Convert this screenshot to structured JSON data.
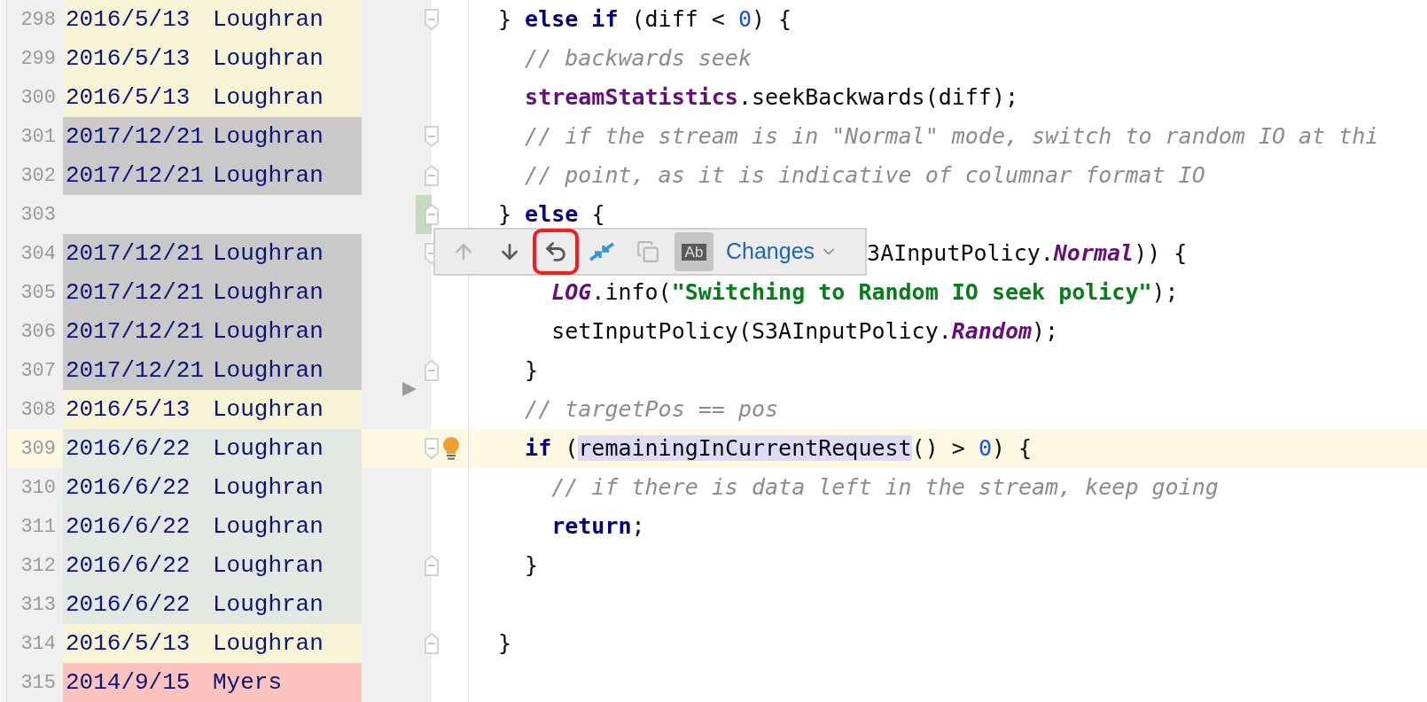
{
  "rows": [
    {
      "line_number": "298",
      "blame": {
        "date": "2016/5/13",
        "author": "Loughran",
        "color": "#f7f3d5"
      },
      "fold_start": true
    },
    {
      "line_number": "299",
      "blame": {
        "date": "2016/5/13",
        "author": "Loughran",
        "color": "#f7f3d5"
      }
    },
    {
      "line_number": "300",
      "blame": {
        "date": "2016/5/13",
        "author": "Loughran",
        "color": "#f7f3d5"
      }
    },
    {
      "line_number": "301",
      "blame": {
        "date": "2017/12/21",
        "author": "Loughran",
        "color": "#c9c9c9"
      },
      "fold_start": true
    },
    {
      "line_number": "302",
      "blame": {
        "date": "2017/12/21",
        "author": "Loughran",
        "color": "#c9c9c9"
      },
      "fold_end": true
    },
    {
      "line_number": "303",
      "changed": true,
      "fold_end": true
    },
    {
      "line_number": "304",
      "blame": {
        "date": "2017/12/21",
        "author": "Loughran",
        "color": "#c9c9c9"
      },
      "fold_start": true
    },
    {
      "line_number": "305",
      "blame": {
        "date": "2017/12/21",
        "author": "Loughran",
        "color": "#c9c9c9"
      }
    },
    {
      "line_number": "306",
      "blame": {
        "date": "2017/12/21",
        "author": "Loughran",
        "color": "#c9c9c9"
      }
    },
    {
      "line_number": "307",
      "blame": {
        "date": "2017/12/21",
        "author": "Loughran",
        "color": "#c9c9c9"
      },
      "fold_end": true
    },
    {
      "line_number": "308",
      "blame": {
        "date": "2016/5/13",
        "author": "Loughran",
        "color": "#f7f3d5"
      },
      "deletion_marker": true
    },
    {
      "line_number": "309",
      "blame": {
        "date": "2016/6/22",
        "author": "Loughran",
        "color": "#e4e8e2"
      },
      "current": true,
      "bulb": true,
      "fold_start": true
    },
    {
      "line_number": "310",
      "blame": {
        "date": "2016/6/22",
        "author": "Loughran",
        "color": "#e4e8e2"
      }
    },
    {
      "line_number": "311",
      "blame": {
        "date": "2016/6/22",
        "author": "Loughran",
        "color": "#e4e8e2"
      }
    },
    {
      "line_number": "312",
      "blame": {
        "date": "2016/6/22",
        "author": "Loughran",
        "color": "#e4e8e2"
      },
      "fold_end": true
    },
    {
      "line_number": "313",
      "blame": {
        "date": "2016/6/22",
        "author": "Loughran",
        "color": "#e4e8e2"
      }
    },
    {
      "line_number": "314",
      "blame": {
        "date": "2016/5/13",
        "author": "Loughran",
        "color": "#f7f3d5"
      },
      "fold_end": true
    },
    {
      "line_number": "315",
      "blame": {
        "date": "2014/9/15",
        "author": "Myers",
        "color": "#fdc3bc"
      }
    }
  ],
  "code": [
    {
      "tokens": [
        {
          "t": "} ",
          "kind": "plain"
        },
        {
          "t": "else if",
          "kind": "keyword"
        },
        {
          "t": " (diff < ",
          "kind": "plain"
        },
        {
          "t": "0",
          "kind": "number"
        },
        {
          "t": ") {",
          "kind": "plain"
        }
      ],
      "children": [
        {
          "tokens": [
            {
              "t": "// backwards seek",
              "kind": "comment"
            }
          ]
        },
        {
          "tokens": [
            {
              "t": "streamStatistics",
              "kind": "field"
            },
            {
              "t": ".seekBackwards(diff);",
              "kind": "plain"
            }
          ]
        },
        {
          "tokens": [
            {
              "t": "// if the stream is in \"Normal\" mode, switch to random IO at thi",
              "kind": "comment"
            }
          ]
        },
        {
          "tokens": [
            {
              "t": "// point, as it is indicative of columnar format IO",
              "kind": "comment"
            }
          ]
        }
      ]
    },
    {
      "tokens": [
        {
          "t": "} ",
          "kind": "plain"
        },
        {
          "t": "else",
          "kind": "keyword"
        },
        {
          "t": " {",
          "kind": "plain"
        }
      ],
      "children": [
        {
          "covered": true,
          "tokens": [
            {
              "t": "3AInputPolicy.",
              "kind": "plain"
            },
            {
              "t": "Normal",
              "kind": "constant"
            },
            {
              "t": ")) {",
              "kind": "plain"
            }
          ],
          "children": [
            {
              "tokens": [
                {
                  "t": "LOG",
                  "kind": "constant"
                },
                {
                  "t": ".info(",
                  "kind": "plain"
                },
                {
                  "t": "\"Switching to Random IO seek policy\"",
                  "kind": "string"
                },
                {
                  "t": ");",
                  "kind": "plain"
                }
              ]
            },
            {
              "tokens": [
                {
                  "t": "setInputPolicy(S3AInputPolicy.",
                  "kind": "plain"
                },
                {
                  "t": "Random",
                  "kind": "constant"
                },
                {
                  "t": ");",
                  "kind": "plain"
                }
              ]
            }
          ]
        },
        {
          "tokens": [
            {
              "t": "}",
              "kind": "plain"
            }
          ]
        },
        {
          "tokens": [
            {
              "t": "// targetPos == pos",
              "kind": "comment"
            }
          ]
        },
        {
          "tokens": [
            {
              "t": "if",
              "kind": "keyword"
            },
            {
              "t": " (",
              "kind": "plain"
            },
            {
              "t": "remainingInCurrentRequest",
              "kind": "match"
            },
            {
              "t": "() > ",
              "kind": "plain"
            },
            {
              "t": "0",
              "kind": "number"
            },
            {
              "t": ") {",
              "kind": "plain"
            }
          ],
          "children": [
            {
              "tokens": [
                {
                  "t": "// if there is data left in the stream, keep going",
                  "kind": "comment"
                }
              ]
            },
            {
              "tokens": [
                {
                  "t": "return",
                  "kind": "keyword"
                },
                {
                  "t": ";",
                  "kind": "plain"
                }
              ]
            }
          ]
        },
        {
          "tokens": [
            {
              "t": "}",
              "kind": "plain"
            }
          ],
          "trailing_blank": true
        }
      ]
    },
    {
      "tokens": [
        {
          "t": "}",
          "kind": "plain"
        }
      ]
    }
  ],
  "diff_toolbar": {
    "buttons": [
      {
        "kind": "up",
        "disabled": true
      },
      {
        "kind": "down",
        "disabled": false
      },
      {
        "kind": "revert",
        "disabled": false,
        "highlighted": true
      },
      {
        "kind": "accept",
        "disabled": false
      },
      {
        "kind": "copy",
        "disabled": true
      },
      {
        "kind": "toggle",
        "label": "Ab",
        "selected": true
      }
    ],
    "dropdown": {
      "label": "Changes"
    }
  }
}
